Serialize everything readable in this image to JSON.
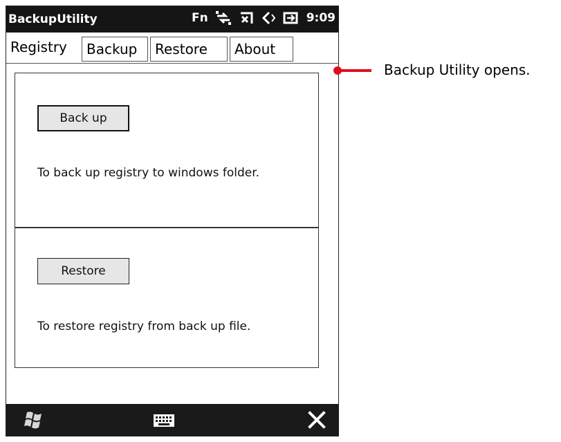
{
  "titlebar": {
    "app_title": "BackupUtility",
    "fn_label": "Fn",
    "time": "9:09"
  },
  "tabs": [
    {
      "label": "Registry",
      "active": true
    },
    {
      "label": "Backup",
      "active": false
    },
    {
      "label": "Restore",
      "active": false
    },
    {
      "label": "About",
      "active": false
    }
  ],
  "backup_section": {
    "button_label": "Back up",
    "description": "To back up registry to windows folder."
  },
  "restore_section": {
    "button_label": "Restore",
    "description": "To restore registry from back up file."
  },
  "taskbar": {
    "start_icon": "windows-start-icon",
    "keyboard_icon": "keyboard-icon",
    "close_icon": "close-icon"
  },
  "callout": {
    "text": "Backup Utility opens.",
    "color": "#e0101b"
  }
}
